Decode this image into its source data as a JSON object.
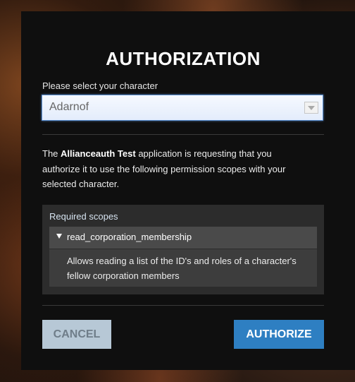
{
  "dialog": {
    "title": "AUTHORIZATION"
  },
  "character_select": {
    "label": "Please select your character",
    "value": "Adarnof"
  },
  "description": {
    "prefix": "The ",
    "app_name": "Allianceauth Test",
    "suffix": " application is requesting that you authorize it to use the following permission scopes with your selected character."
  },
  "scopes": {
    "header": "Required scopes",
    "items": [
      {
        "name": "read_corporation_membership",
        "description": "Allows reading a list of the ID's and roles of a character's fellow corporation members"
      }
    ]
  },
  "buttons": {
    "cancel_label": "CANCEL",
    "authorize_label": "AUTHORIZE"
  },
  "colors": {
    "authorize_button": "#2e7fc2",
    "cancel_button": "#b7c8d6",
    "panel_background": "#0f0f0f"
  },
  "icons": {
    "select_caret": "chevron-down-icon",
    "scope_toggle": "triangle-down-icon"
  }
}
